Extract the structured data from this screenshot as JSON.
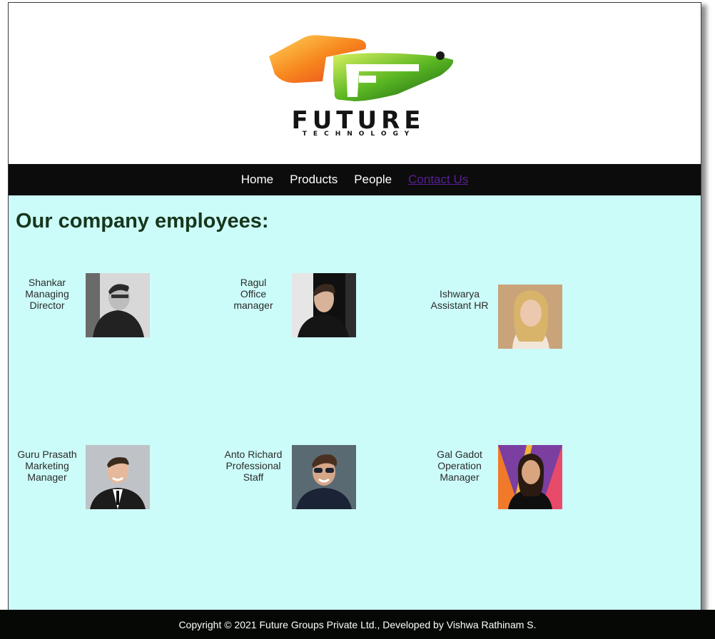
{
  "brand": {
    "logo_word": "FUTURE",
    "logo_subword": "TECHNOLOGY"
  },
  "nav": {
    "items": [
      {
        "label": "Home"
      },
      {
        "label": "Products"
      },
      {
        "label": "People"
      },
      {
        "label": "Contact Us"
      }
    ]
  },
  "main": {
    "heading": "Our company employees:",
    "employees": [
      {
        "name": "Shankar",
        "role_line1": "Managing",
        "role_line2": "Director"
      },
      {
        "name": "Ragul",
        "role_line1": "Office",
        "role_line2": "manager"
      },
      {
        "name": "Ishwarya",
        "role_line1": "Assistant HR",
        "role_line2": ""
      },
      {
        "name": "Guru Prasath",
        "role_line1": "Marketing",
        "role_line2": "Manager"
      },
      {
        "name": "Anto Richard",
        "role_line1": "Professional",
        "role_line2": "Staff"
      },
      {
        "name": "Gal Gadot",
        "role_line1": "Operation",
        "role_line2": "Manager"
      }
    ]
  },
  "footer": {
    "text": "Copyright © 2021 Future Groups Private Ltd., Developed by Vishwa Rathinam S."
  },
  "colors": {
    "nav_bg": "#0c0c0c",
    "main_bg": "#ccfcf9",
    "heading": "#17361c",
    "visited_link": "#5a1f96",
    "footer_bg": "#050805"
  }
}
